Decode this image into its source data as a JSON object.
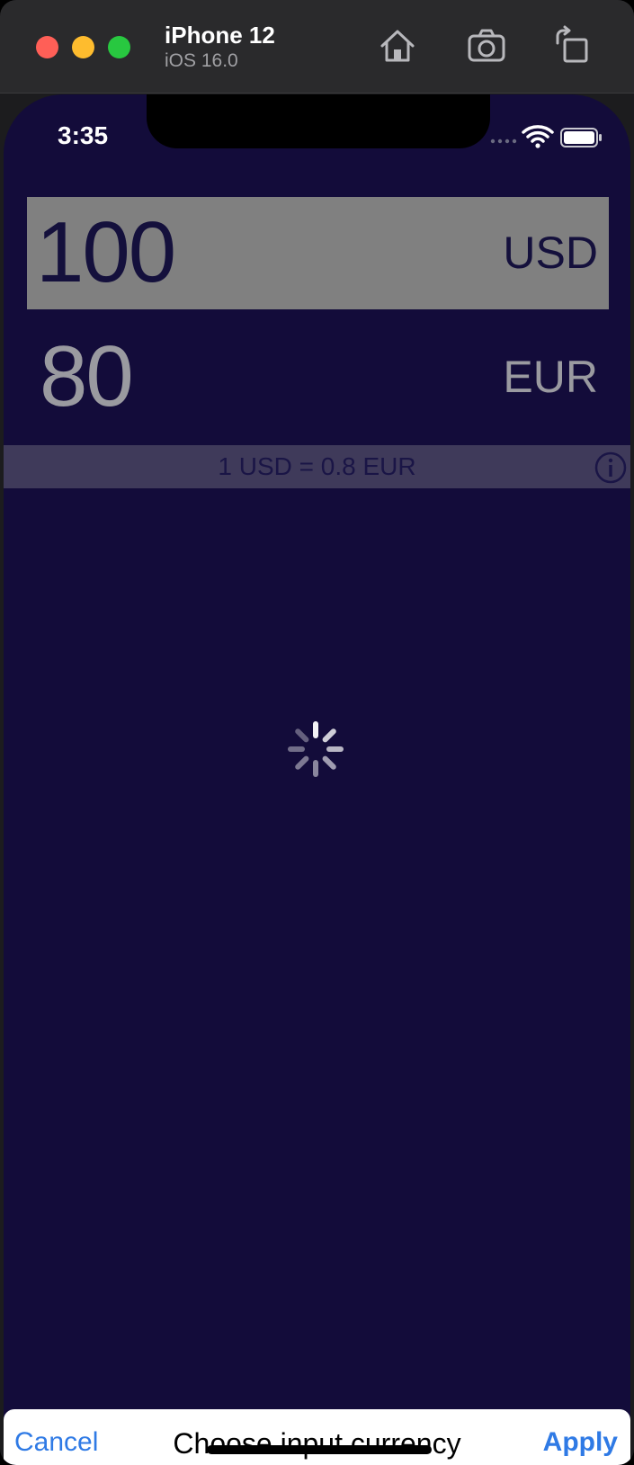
{
  "simulator": {
    "device_name": "iPhone 12",
    "os_version": "iOS 16.0"
  },
  "status_bar": {
    "time": "3:35"
  },
  "converter": {
    "input_value": "100",
    "input_currency": "USD",
    "output_value": "80",
    "output_currency": "EUR",
    "rate_text": "1 USD = 0.8 EUR"
  },
  "picker_sheet": {
    "cancel_label": "Cancel",
    "title": "Choose input currency",
    "apply_label": "Apply"
  },
  "colors": {
    "background": "#130c3a",
    "input_highlight": "#808080",
    "rate_bar": "#3f3a5a",
    "accent": "#2f7ae5"
  },
  "icons": {
    "home": "home-icon",
    "screenshot": "camera-icon",
    "rotate": "rotate-icon",
    "info": "info-icon",
    "loading": "activity-spinner-icon"
  }
}
